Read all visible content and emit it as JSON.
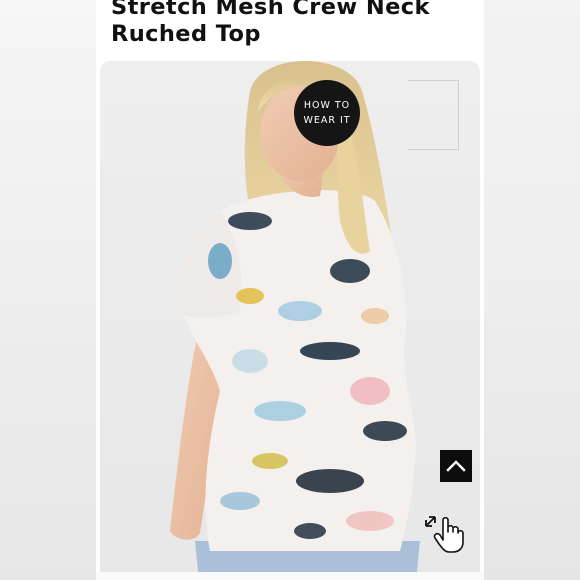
{
  "product": {
    "title": "Stretch Mesh Crew Neck Ruched Top"
  },
  "badges": {
    "how_to_line1": "HOW TO",
    "how_to_line2": "WEAR IT"
  },
  "controls": {
    "back_to_top_icon": "chevron-up-icon",
    "zoom_icon": "hand-pointer-expand-icon"
  },
  "colors": {
    "page_bg": "#f2f2f2",
    "card_bg": "#ffffff",
    "title": "#111111",
    "badge_bg": "#151515",
    "button_bg": "#0d0d0d"
  }
}
